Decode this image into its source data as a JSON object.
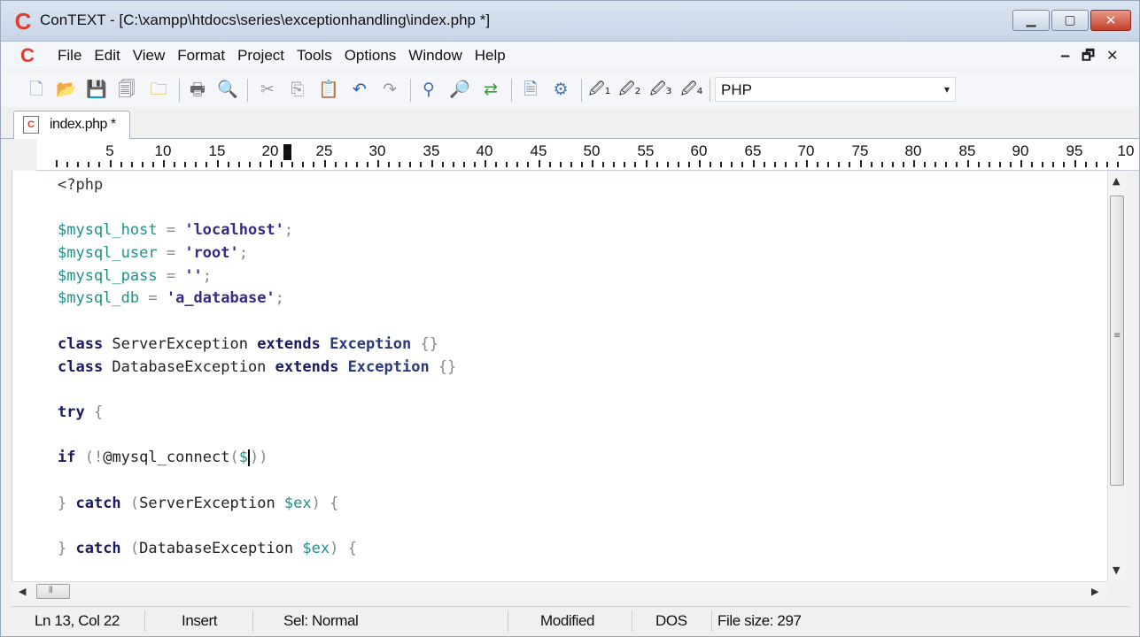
{
  "window": {
    "title": "ConTEXT - [C:\\xampp\\htdocs\\series\\exceptionhandling\\index.php *]",
    "logo_letter": "C",
    "min_glyph": "▁",
    "max_glyph": "▢",
    "close_glyph": "✕"
  },
  "menu": {
    "items": [
      "File",
      "Edit",
      "View",
      "Format",
      "Project",
      "Tools",
      "Options",
      "Window",
      "Help"
    ],
    "minimize_glyph": "‒",
    "restore_glyph": "🗗",
    "close_glyph": "✕"
  },
  "toolbar": {
    "language": "PHP",
    "dropdown_glyph": "▾",
    "icons": [
      "new-file-icon",
      "open-folder-icon",
      "save-icon",
      "save-all-icon",
      "open-recent-icon",
      "print-icon",
      "print-preview-icon",
      "cut-icon",
      "copy-icon",
      "paste-icon",
      "undo-icon",
      "redo-icon",
      "find-icon",
      "find-next-icon",
      "replace-icon",
      "export-icon",
      "settings-icon",
      "user-command-1-icon",
      "user-command-2-icon",
      "user-command-3-icon",
      "user-command-4-icon"
    ]
  },
  "tabs": [
    {
      "label": "index.php *"
    }
  ],
  "ruler": {
    "numbers": [
      "5",
      "10",
      "15",
      "20",
      "25",
      "30",
      "35",
      "40",
      "45",
      "50",
      "55",
      "60",
      "65",
      "70",
      "75",
      "80",
      "85",
      "90",
      "95",
      "10"
    ]
  },
  "editor": {
    "lines": [
      "<?php",
      "",
      "$mysql_host = 'localhost';",
      "$mysql_user = 'root';",
      "$mysql_pass = '';",
      "$mysql_db = 'a_database';",
      "",
      "class ServerException extends Exception {}",
      "class DatabaseException extends Exception {}",
      "",
      "try {",
      "",
      "if (!@mysql_connect($))",
      "",
      "} catch (ServerException $ex) {",
      "",
      "} catch (DatabaseException $ex) {"
    ]
  },
  "status": {
    "position": "Ln 13, Col 22",
    "mode": "Insert",
    "selection": "Sel: Normal",
    "modified": "Modified",
    "line_ending": "DOS",
    "file_size": "File size: 297"
  },
  "colors": {
    "keyword": "#1a1a5e",
    "variable": "#1f8f8a",
    "string": "#3a2a80",
    "logo": "#e23c2b"
  }
}
